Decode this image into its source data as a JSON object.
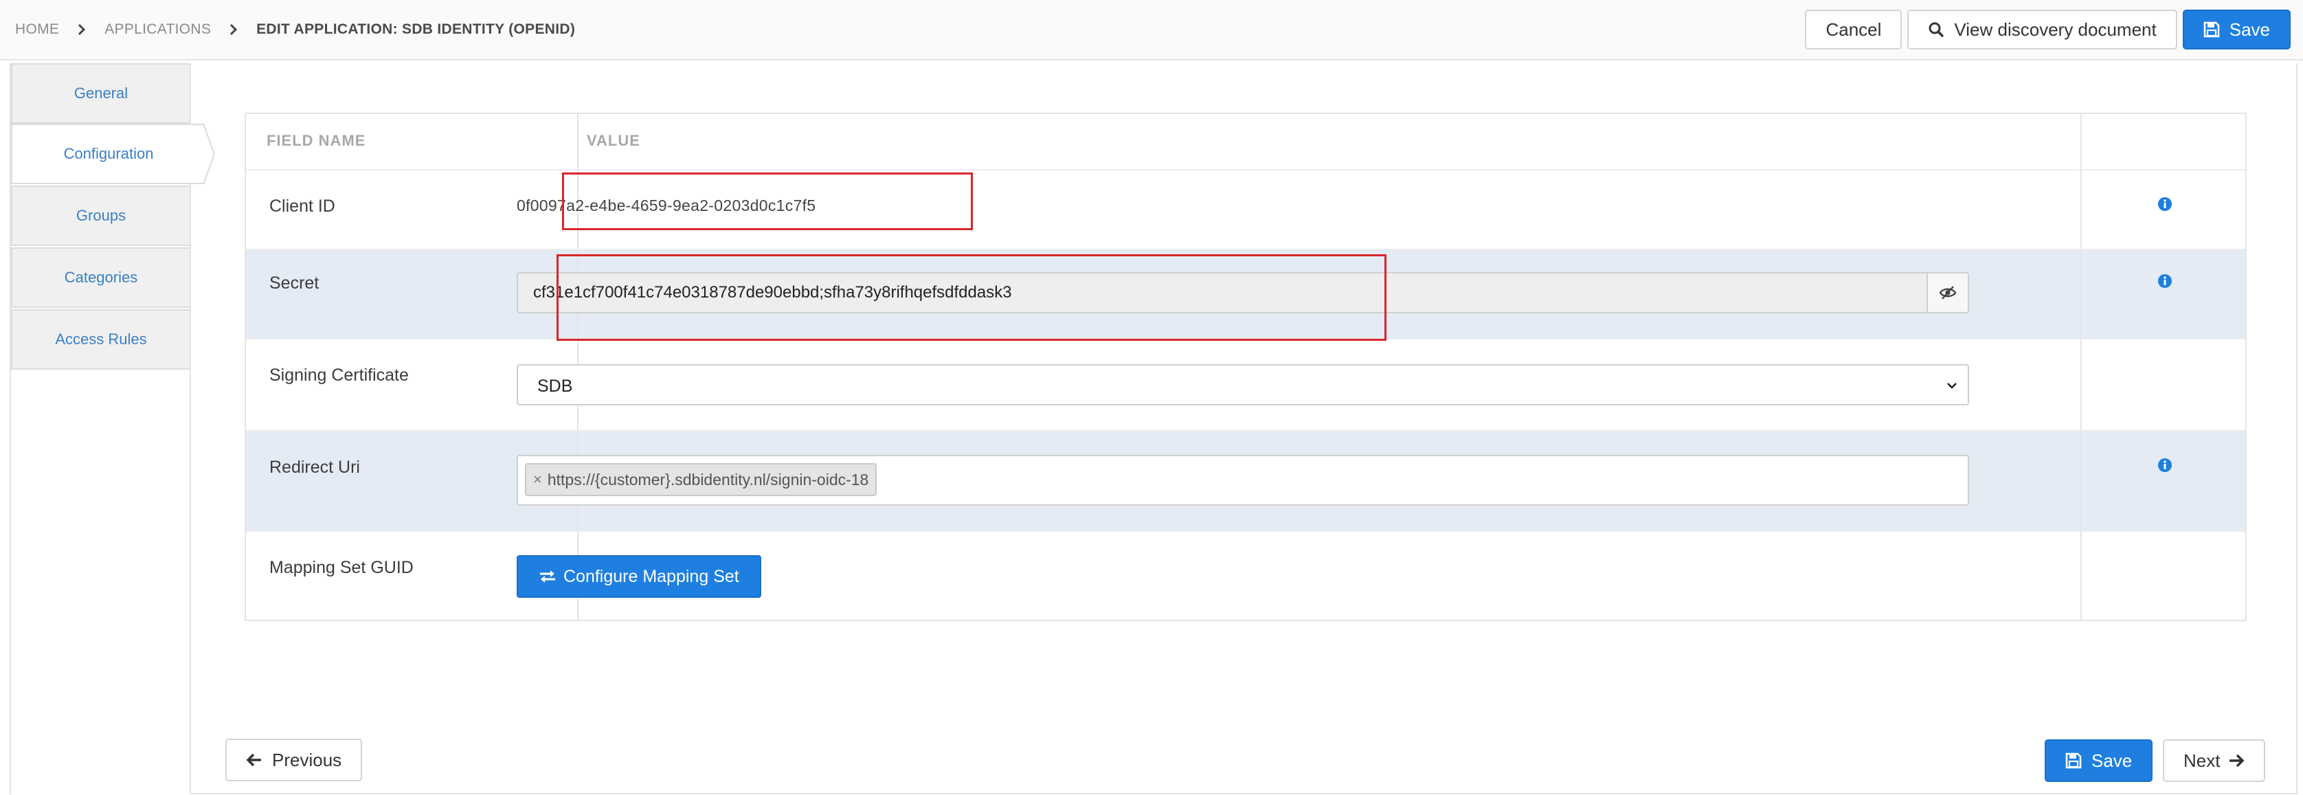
{
  "breadcrumb": {
    "home": "HOME",
    "applications": "APPLICATIONS",
    "current": "EDIT APPLICATION: SDB IDENTITY (OPENID)"
  },
  "top_actions": {
    "cancel": "Cancel",
    "view_discovery": "View discovery document",
    "save": "Save"
  },
  "tabs": [
    {
      "label": "General",
      "active": false
    },
    {
      "label": "Configuration",
      "active": true
    },
    {
      "label": "Groups",
      "active": false
    },
    {
      "label": "Categories",
      "active": false
    },
    {
      "label": "Access Rules",
      "active": false
    }
  ],
  "table": {
    "header_field": "FIELD NAME",
    "header_value": "VALUE",
    "rows": {
      "client_id": {
        "label": "Client ID",
        "value": "0f0097a2-e4be-4659-9ea2-0203d0c1c7f5"
      },
      "secret": {
        "label": "Secret",
        "value": "cf31e1cf700f41c74e0318787de90ebbd;sfha73y8rifhqefsdfddask3"
      },
      "signing_certificate": {
        "label": "Signing Certificate",
        "value": "SDB"
      },
      "redirect_uri": {
        "label": "Redirect Uri",
        "tags": [
          "https://{customer}.sdbidentity.nl/signin-oidc-18"
        ]
      },
      "mapping_set": {
        "label": "Mapping Set GUID",
        "button": "Configure Mapping Set"
      }
    }
  },
  "bottom_nav": {
    "previous": "Previous",
    "save": "Save",
    "next": "Next"
  },
  "colors": {
    "primary": "#1e7fe0",
    "link": "#3b7fc4",
    "row_alt": "#e4ebf4",
    "highlight": "#d9262c"
  }
}
